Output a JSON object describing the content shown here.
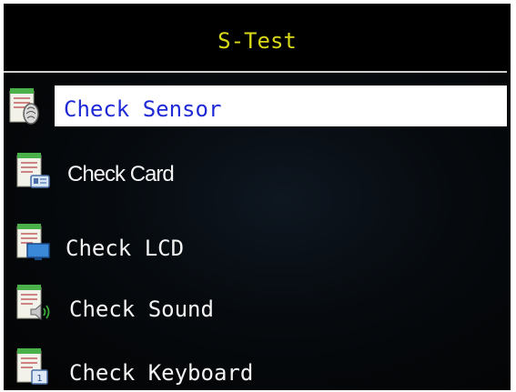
{
  "header": {
    "title": "S-Test"
  },
  "menu": {
    "selected_index": 0,
    "items": [
      {
        "label": "Check Sensor",
        "icon": "sensor-icon"
      },
      {
        "label": "Check Card",
        "icon": "card-icon"
      },
      {
        "label": "Check LCD",
        "icon": "lcd-icon"
      },
      {
        "label": "Check Sound",
        "icon": "sound-icon"
      },
      {
        "label": "Check Keyboard",
        "icon": "keyboard-icon"
      }
    ]
  },
  "colors": {
    "title": "#d8d818",
    "selected_text": "#1f2ad6",
    "selected_bg": "#ffffff",
    "item_text": "#f4f4f4",
    "background": "#050505"
  }
}
